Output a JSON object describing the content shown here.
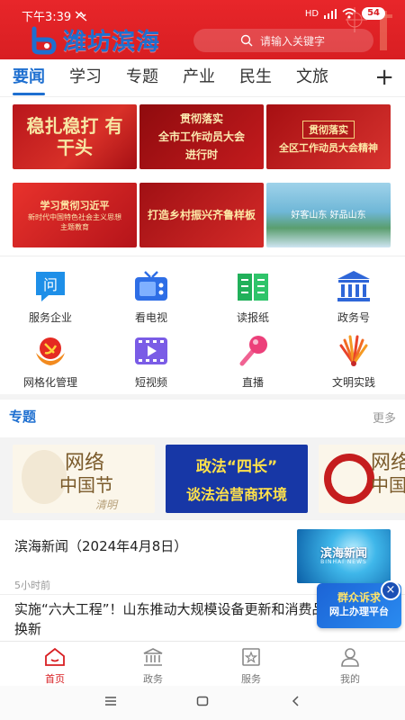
{
  "status": {
    "time": "下午3:39",
    "battery": "54",
    "signal": "HD"
  },
  "header": {
    "app_name": "潍坊滨海",
    "search_placeholder": "请输入关键字",
    "brand_color": "#d81e22",
    "accent": "#1e6fd0"
  },
  "tabs": {
    "items": [
      "要闻",
      "学习",
      "专题",
      "产业",
      "民生",
      "文旅"
    ],
    "active": "要闻",
    "add": "+"
  },
  "banners": [
    {
      "text": "稳扎稳打 有干头"
    },
    {
      "line1": "贯彻落实",
      "line2": "全市工作动员大会",
      "line3": "进行时"
    },
    {
      "line1": "贯彻落实",
      "line2": "全区工作动员大会精神"
    },
    {
      "line1": "学习贯彻习近平",
      "line2": "新时代中国特色社会主义思想",
      "line3": "主题教育"
    },
    {
      "text": "打造乡村振兴齐鲁样板"
    },
    {
      "text": "好客山东 好品山东"
    }
  ],
  "services": [
    {
      "label": "服务企业",
      "icon": "chat-icon"
    },
    {
      "label": "看电视",
      "icon": "tv-icon"
    },
    {
      "label": "读报纸",
      "icon": "newspaper-icon"
    },
    {
      "label": "政务号",
      "icon": "government-icon"
    },
    {
      "label": "网格化管理",
      "icon": "party-emblem-icon"
    },
    {
      "label": "短视频",
      "icon": "video-icon"
    },
    {
      "label": "直播",
      "icon": "microphone-icon"
    },
    {
      "label": "文明实践",
      "icon": "fan-icon"
    }
  ],
  "topics": {
    "title": "专题",
    "more": "更多",
    "cards": [
      {
        "line1": "网络",
        "line2": "中国节",
        "line3": "清明"
      },
      {
        "line1": "政法“四长”",
        "line2": "谈法治营商环境"
      },
      {
        "line1": "网络",
        "line2": "中国"
      }
    ]
  },
  "news": [
    {
      "title": "滨海新闻（2024年4月8日）",
      "meta": "5小时前",
      "thumb_title": "滨海新闻",
      "thumb_sub": "BINHAI NEWS"
    },
    {
      "title": "实施“六大工程”！山东推动大规模设备更新和消费品以旧换新"
    }
  ],
  "float_ad": {
    "line1": "群众诉求",
    "line2": "网上办理平台",
    "close": "×"
  },
  "bottom_nav": [
    {
      "label": "首页",
      "icon": "home-icon",
      "active": true
    },
    {
      "label": "政务",
      "icon": "bank-icon",
      "active": false
    },
    {
      "label": "服务",
      "icon": "star-flag-icon",
      "active": false
    },
    {
      "label": "我的",
      "icon": "user-icon",
      "active": false
    }
  ]
}
